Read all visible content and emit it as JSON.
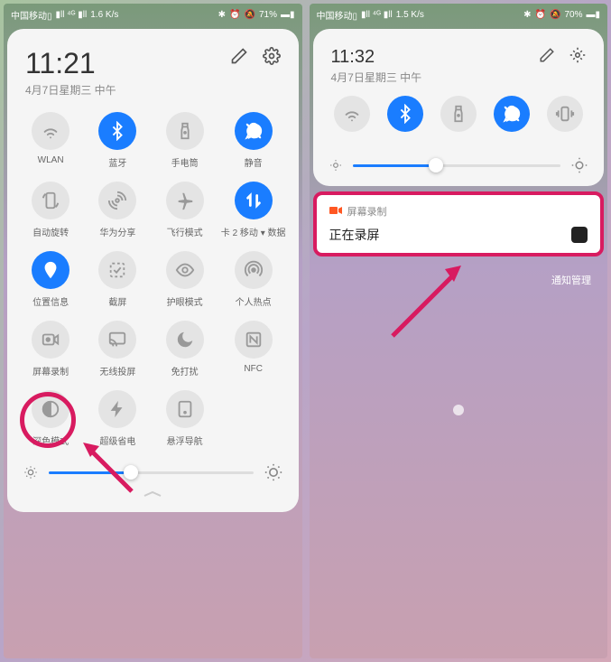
{
  "left": {
    "status": {
      "net_speed": "1.6 K/s",
      "battery_text": "71%"
    },
    "time": "11:21",
    "date": "4月7日星期三 中午",
    "tiles": [
      {
        "id": "wlan",
        "label": "WLAN",
        "active": false
      },
      {
        "id": "bluetooth",
        "label": "蓝牙",
        "active": true
      },
      {
        "id": "flashlight",
        "label": "手电筒",
        "active": false
      },
      {
        "id": "mute",
        "label": "静音",
        "active": true
      },
      {
        "id": "autorotate",
        "label": "自动旋转",
        "active": false
      },
      {
        "id": "huaweishare",
        "label": "华为分享",
        "active": false
      },
      {
        "id": "airplane",
        "label": "飞行模式",
        "active": false
      },
      {
        "id": "mobiledata",
        "label": "卡 2 移动 ▾ 数据",
        "active": true
      },
      {
        "id": "location",
        "label": "位置信息",
        "active": true
      },
      {
        "id": "screenshot",
        "label": "截屏",
        "active": false
      },
      {
        "id": "eyecomfort",
        "label": "护眼模式",
        "active": false
      },
      {
        "id": "hotspot",
        "label": "个人热点",
        "active": false
      },
      {
        "id": "screenrecord",
        "label": "屏幕录制",
        "active": false
      },
      {
        "id": "wirelesscast",
        "label": "无线投屏",
        "active": false
      },
      {
        "id": "dnd",
        "label": "免打扰",
        "active": false
      },
      {
        "id": "nfc",
        "label": "NFC",
        "active": false
      },
      {
        "id": "darkmode",
        "label": "深色模式",
        "active": false
      },
      {
        "id": "powersave",
        "label": "超级省电",
        "active": false
      },
      {
        "id": "floatnav",
        "label": "悬浮导航",
        "active": false
      }
    ],
    "brightness_pct": 40
  },
  "right": {
    "status": {
      "net_speed": "1.5 K/s",
      "battery_text": "70%"
    },
    "time": "11:32",
    "date": "4月7日星期三 中午",
    "quick_tiles": [
      {
        "id": "wlan",
        "active": false
      },
      {
        "id": "bluetooth",
        "active": true
      },
      {
        "id": "flashlight",
        "active": false
      },
      {
        "id": "mute",
        "active": true
      },
      {
        "id": "vibrate",
        "active": false
      }
    ],
    "brightness_pct": 40,
    "notif": {
      "app": "屏幕录制",
      "body": "正在录屏"
    },
    "notif_manage": "通知管理"
  }
}
